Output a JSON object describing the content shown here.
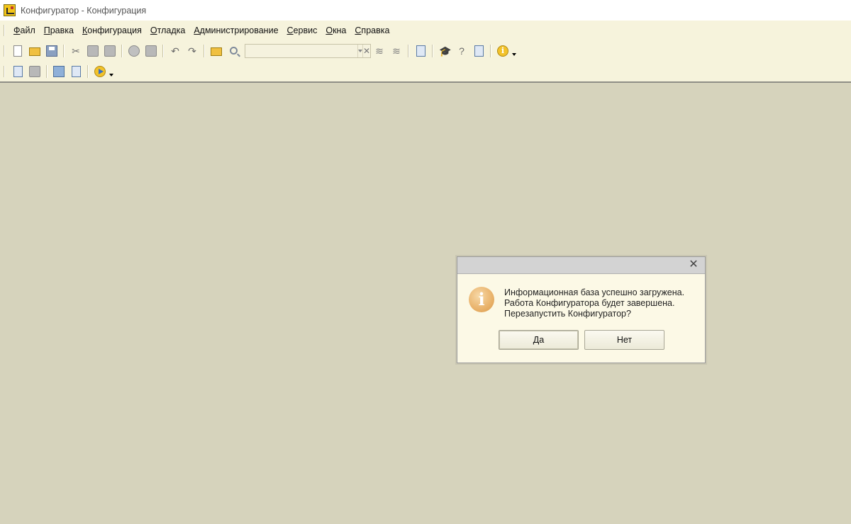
{
  "window": {
    "title": "Конфигуратор - Конфигурация"
  },
  "menu": {
    "items": [
      "Файл",
      "Правка",
      "Конфигурация",
      "Отладка",
      "Администрирование",
      "Сервис",
      "Окна",
      "Справка"
    ]
  },
  "toolbar": {
    "search_value": ""
  },
  "dialog": {
    "line1": "Информационная база успешно загружена.",
    "line2": "Работа Конфигуратора будет завершена.",
    "line3": "Перезапустить Конфигуратор?",
    "yes_label": "Да",
    "no_label": "Нет",
    "icon": "info-icon"
  },
  "colors": {
    "workspace": "#d6d3bc",
    "menubar": "#f6f3dc",
    "dialog_bg": "#fcf9e6"
  }
}
